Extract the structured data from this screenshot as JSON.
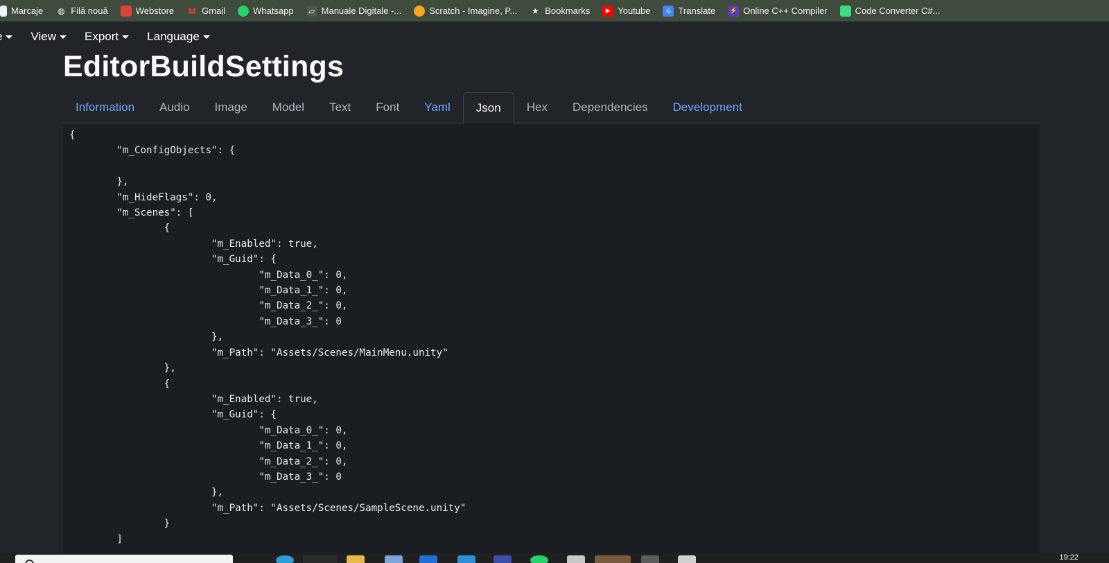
{
  "bookmarks": [
    {
      "label": "Marcaje",
      "icon": "bookmark-folder-icon"
    },
    {
      "label": "Filă nouă",
      "icon": "globe-icon"
    },
    {
      "label": "Webstore",
      "icon": "webstore-icon"
    },
    {
      "label": "Gmail",
      "icon": "gmail-icon"
    },
    {
      "label": "Whatsapp",
      "icon": "whatsapp-icon"
    },
    {
      "label": "Manuale Digitale -...",
      "icon": "manuale-icon"
    },
    {
      "label": "Scratch - Imagine, P...",
      "icon": "scratch-icon"
    },
    {
      "label": "Bookmarks",
      "icon": "star-icon"
    },
    {
      "label": "Youtube",
      "icon": "youtube-icon"
    },
    {
      "label": "Translate",
      "icon": "translate-icon"
    },
    {
      "label": "Online C++ Compiler",
      "icon": "compiler-icon"
    },
    {
      "label": "Code Converter C#...",
      "icon": "code-converter-icon"
    }
  ],
  "menu": {
    "file_label": "e",
    "view_label": "View",
    "export_label": "Export",
    "language_label": "Language"
  },
  "page_title": "EditorBuildSettings",
  "tabs": [
    {
      "label": "Information",
      "state": "link"
    },
    {
      "label": "Audio",
      "state": "normal"
    },
    {
      "label": "Image",
      "state": "normal"
    },
    {
      "label": "Model",
      "state": "normal"
    },
    {
      "label": "Text",
      "state": "normal"
    },
    {
      "label": "Font",
      "state": "normal"
    },
    {
      "label": "Yaml",
      "state": "link"
    },
    {
      "label": "Json",
      "state": "active"
    },
    {
      "label": "Hex",
      "state": "normal"
    },
    {
      "label": "Dependencies",
      "state": "normal"
    },
    {
      "label": "Development",
      "state": "link"
    }
  ],
  "code_text": "{\n\t\"m_ConfigObjects\": {\n\n\t},\n\t\"m_HideFlags\": 0,\n\t\"m_Scenes\": [\n\t\t{\n\t\t\t\"m_Enabled\": true,\n\t\t\t\"m_Guid\": {\n\t\t\t\t\"m_Data_0_\": 0,\n\t\t\t\t\"m_Data_1_\": 0,\n\t\t\t\t\"m_Data_2_\": 0,\n\t\t\t\t\"m_Data_3_\": 0\n\t\t\t},\n\t\t\t\"m_Path\": \"Assets/Scenes/MainMenu.unity\"\n\t\t},\n\t\t{\n\t\t\t\"m_Enabled\": true,\n\t\t\t\"m_Guid\": {\n\t\t\t\t\"m_Data_0_\": 0,\n\t\t\t\t\"m_Data_1_\": 0,\n\t\t\t\t\"m_Data_2_\": 0,\n\t\t\t\t\"m_Data_3_\": 0\n\t\t\t},\n\t\t\t\"m_Path\": \"Assets/Scenes/SampleScene.unity\"\n\t\t}\n\t]",
  "taskbar": {
    "clock": "19:22"
  },
  "colors": {
    "background": "#212529",
    "code_background": "#1a1d21",
    "link": "#6ea8fe",
    "bookmarks_bar": "#3f4b3c"
  }
}
